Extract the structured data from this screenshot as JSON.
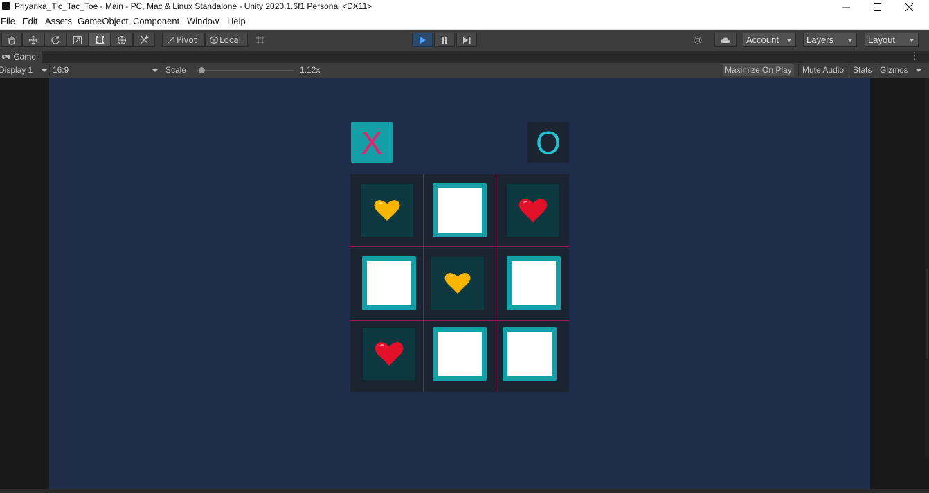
{
  "window": {
    "title": "Priyanka_Tic_Tac_Toe - Main - PC, Mac & Linux Standalone - Unity 2020.1.6f1 Personal <DX11>",
    "minimize_icon": "minimize-icon",
    "maximize_icon": "maximize-icon",
    "close_icon": "close-icon"
  },
  "menu": [
    "File",
    "Edit",
    "Assets",
    "GameObject",
    "Component",
    "Window",
    "Help"
  ],
  "toolbar": {
    "tools": [
      "hand-icon",
      "move-icon",
      "rotate-icon",
      "scale-icon",
      "rect-icon",
      "transform-icon",
      "custom-tool-icon"
    ],
    "pivot_label": "Pivot",
    "local_label": "Local",
    "grid_snap_icon": "grid-snap-icon",
    "play_icon": "play-icon",
    "pause_icon": "pause-icon",
    "step_icon": "step-icon",
    "collab_icon": "collab-icon",
    "cloud_icon": "cloud-icon",
    "account_label": "Account",
    "layers_label": "Layers",
    "layout_label": "Layout"
  },
  "game_tab": {
    "label": "Game",
    "icon": "gamepad-icon",
    "display": "Display 1",
    "aspect": "16:9",
    "scale_label": "Scale",
    "scale_value": "1.12x",
    "scale_level": 0.05,
    "maximize_on_play": "Maximize On Play",
    "mute_audio": "Mute Audio",
    "stats": "Stats",
    "gizmos": "Gizmos"
  },
  "game": {
    "x_label": "X",
    "o_label": "O",
    "colors": {
      "background": "#1f2d4a",
      "tile_teal": "#149fa6",
      "x_pink": "#e3236b",
      "o_cyan": "#1fc3cf",
      "grid_line": "#8a1e58",
      "filled_cell": "#0d3840",
      "heart_red": "#e3102a",
      "heart_yellow": "#f7b500"
    },
    "board": [
      [
        "yellow-heart",
        "empty",
        "red-heart"
      ],
      [
        "empty",
        "yellow-heart",
        "empty"
      ],
      [
        "red-heart",
        "empty",
        "empty"
      ]
    ]
  }
}
